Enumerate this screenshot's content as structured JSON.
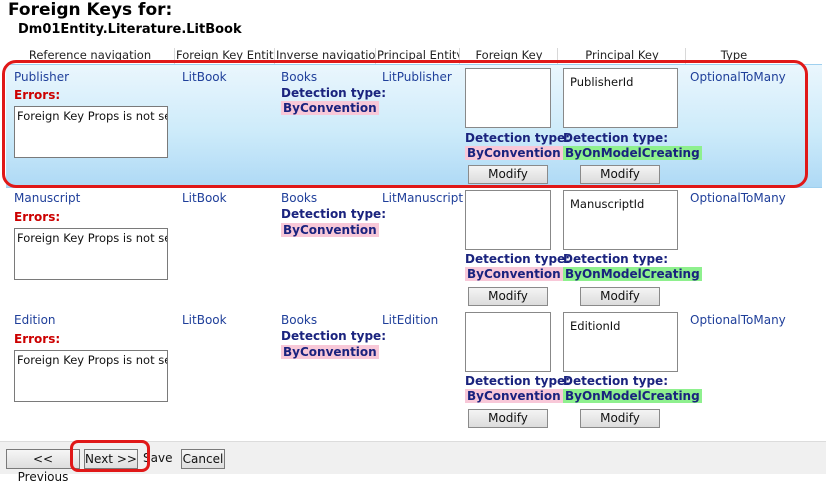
{
  "title": "Foreign Keys for:",
  "subtitle": "Dm01Entity.Literature.LitBook",
  "columns": [
    "Reference navigation",
    "Foreign Key Entity",
    "Inverse navigation",
    "Principal Entity",
    "Foreign Key",
    "Principal Key",
    "Type"
  ],
  "detection_label": "Detection type:",
  "errors_label": "Errors:",
  "modify_label": "Modify",
  "rows": [
    {
      "ref_nav": "Publisher",
      "error_text": "Foreign Key Props is not set.",
      "fk_entity": "LitBook",
      "inverse_nav": "Books",
      "inverse_detection": "ByConvention",
      "principal_entity": "LitPublisher",
      "foreign_key": "",
      "fk_detection": "ByConvention",
      "principal_key": "PublisherId",
      "pk_detection": "ByOnModelCreating",
      "type": "OptionalToMany"
    },
    {
      "ref_nav": "Manuscript",
      "error_text": "Foreign Key Props is not set.",
      "fk_entity": "LitBook",
      "inverse_nav": "Books",
      "inverse_detection": "ByConvention",
      "principal_entity": "LitManuscript",
      "foreign_key": "",
      "fk_detection": "ByConvention",
      "principal_key": "ManuscriptId",
      "pk_detection": "ByOnModelCreating",
      "type": "OptionalToMany"
    },
    {
      "ref_nav": "Edition",
      "error_text": "Foreign Key Props is not set.",
      "fk_entity": "LitBook",
      "inverse_nav": "Books",
      "inverse_detection": "ByConvention",
      "principal_entity": "LitEdition",
      "foreign_key": "",
      "fk_detection": "ByConvention",
      "principal_key": "EditionId",
      "pk_detection": "ByOnModelCreating",
      "type": "OptionalToMany"
    }
  ],
  "footer": {
    "previous": "<< Previous",
    "next": "Next >>",
    "save": "Save",
    "cancel": "Cancel"
  },
  "colors": {
    "accent_ring": "#e01818",
    "selected_row": "#cdebfa",
    "convention": "#f8c8d8",
    "model_creating": "#8ef08e"
  }
}
